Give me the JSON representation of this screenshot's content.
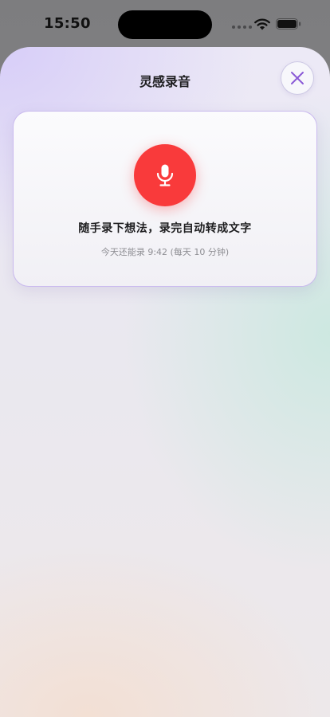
{
  "status_bar": {
    "time": "15:50"
  },
  "sheet": {
    "title": "灵感录音",
    "close_icon": "close-icon"
  },
  "recorder": {
    "mic_icon": "microphone-icon",
    "headline": "随手录下想法，录完自动转成文字",
    "quota": "今天还能录 9:42 (每天 10 分钟)"
  },
  "colors": {
    "record_red": "#f93a3b",
    "close_accent": "#8a5ad6"
  }
}
